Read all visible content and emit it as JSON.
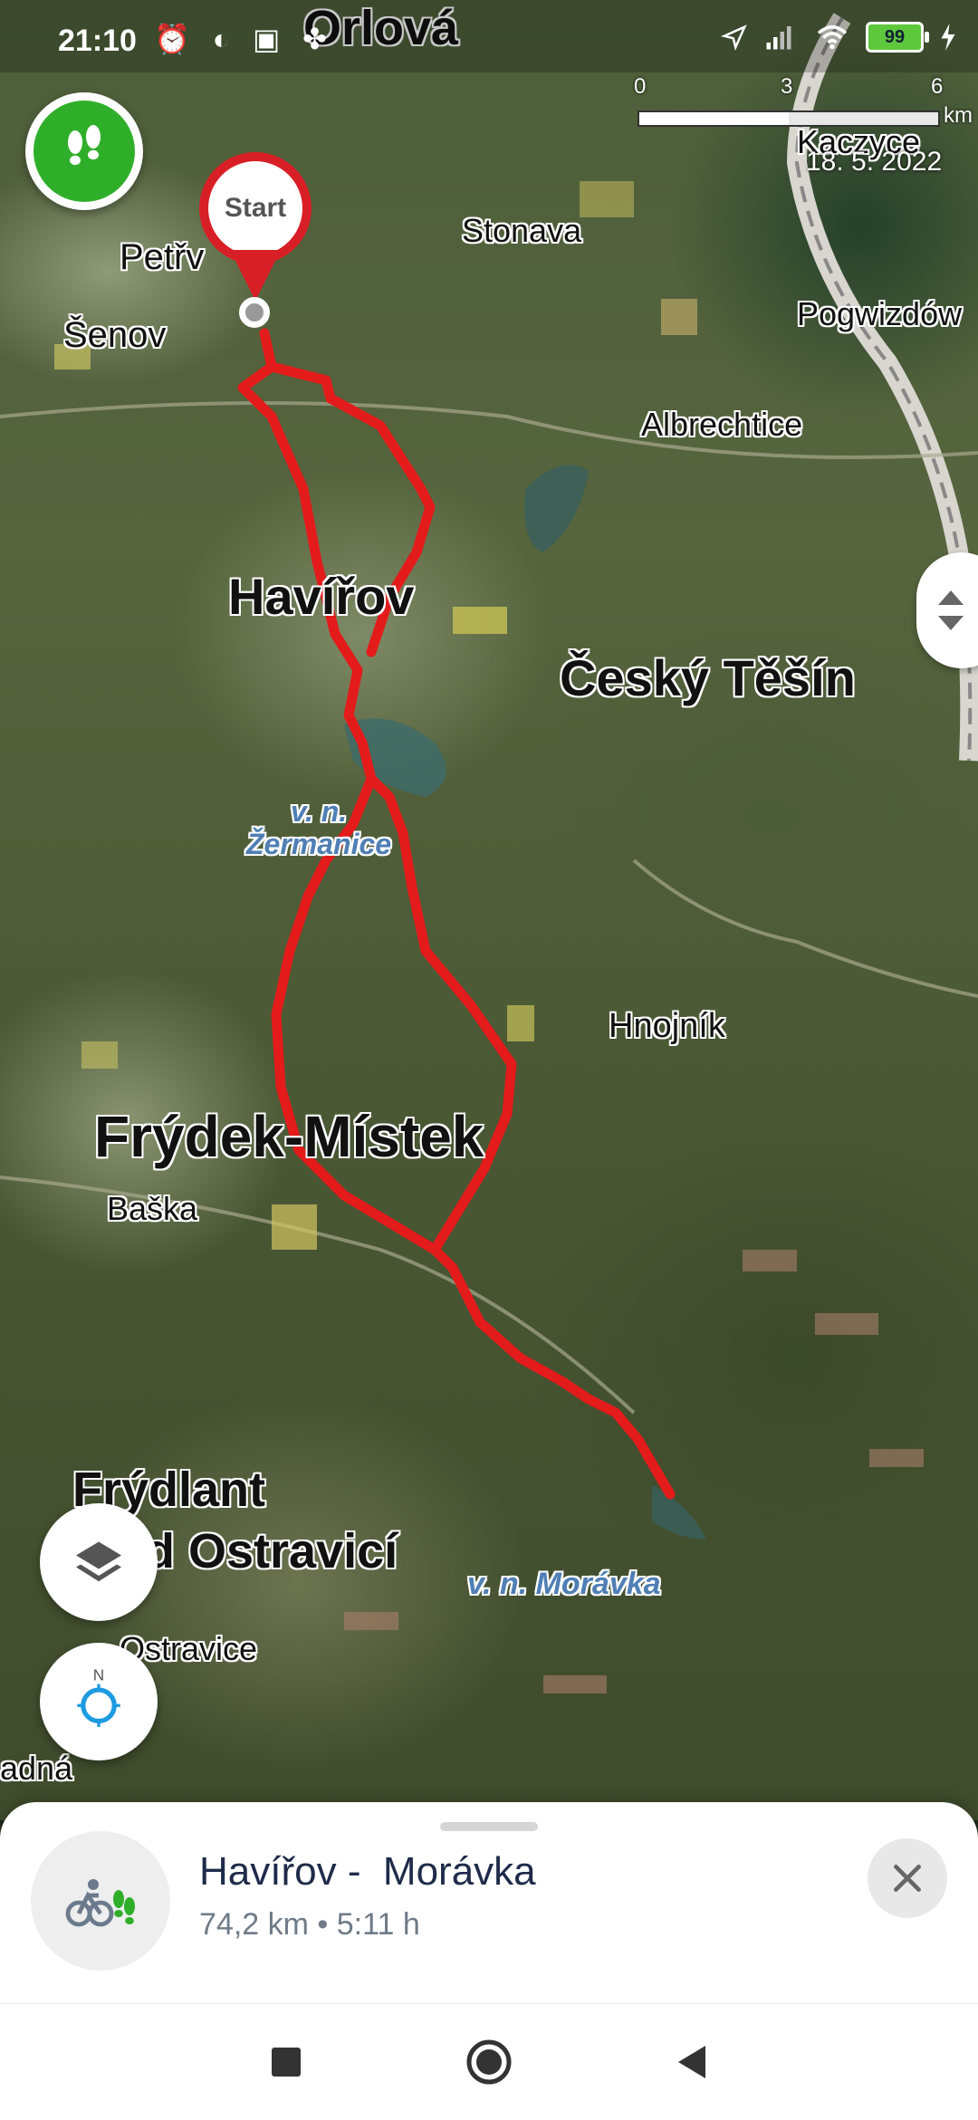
{
  "status_bar": {
    "time": "21:10",
    "left_icons": [
      "alarm-icon",
      "moon-icon",
      "sim-icon",
      "fan-icon"
    ],
    "right_icons": [
      "location-icon",
      "signal-icon",
      "wifi-icon"
    ],
    "battery": "99"
  },
  "map": {
    "title_label": "Orlová",
    "scale": {
      "ticks": [
        "0",
        "3",
        "6"
      ],
      "unit": "km"
    },
    "imagery_date": "18. 5. 2022",
    "place_labels": {
      "kaczyce": "Kaczyce",
      "petrvald": "Petřv",
      "senov": "Šenov",
      "stonava": "Stonava",
      "pogwizdow": "Pogwizdów",
      "albrechtice": "Albrechtice",
      "havirov": "Havířov",
      "cesky_tesin": "Český Těšín",
      "zermanice": "v. n.\nŽermanice",
      "hnojnik": "Hnojník",
      "frydek_mistek": "Frýdek-Místek",
      "baska": "Baška",
      "frydlant_line1": "Frýdlant",
      "frydlant_line2": "d Ostravicí",
      "moravka": "v. n. Morávka",
      "ostravice": "Ostravice",
      "radna": "adná"
    },
    "start_pin_label": "Start",
    "route_color": "#e31b1b"
  },
  "controls": {
    "route_fab_icon": "footprints-icon",
    "layers_icon": "layers-icon",
    "compass_icon": "compass-icon",
    "compass_letter": "N",
    "side_handle_icon": "expand-vertical-icon"
  },
  "sheet": {
    "route_icon": "bike-hike-icon",
    "title": "Havířov -  Morávka",
    "meta": "74,2 km • 5:11 h",
    "close_icon": "close-icon"
  },
  "nav": {
    "recents_icon": "square-icon",
    "home_icon": "circle-icon",
    "back_icon": "triangle-back-icon"
  }
}
